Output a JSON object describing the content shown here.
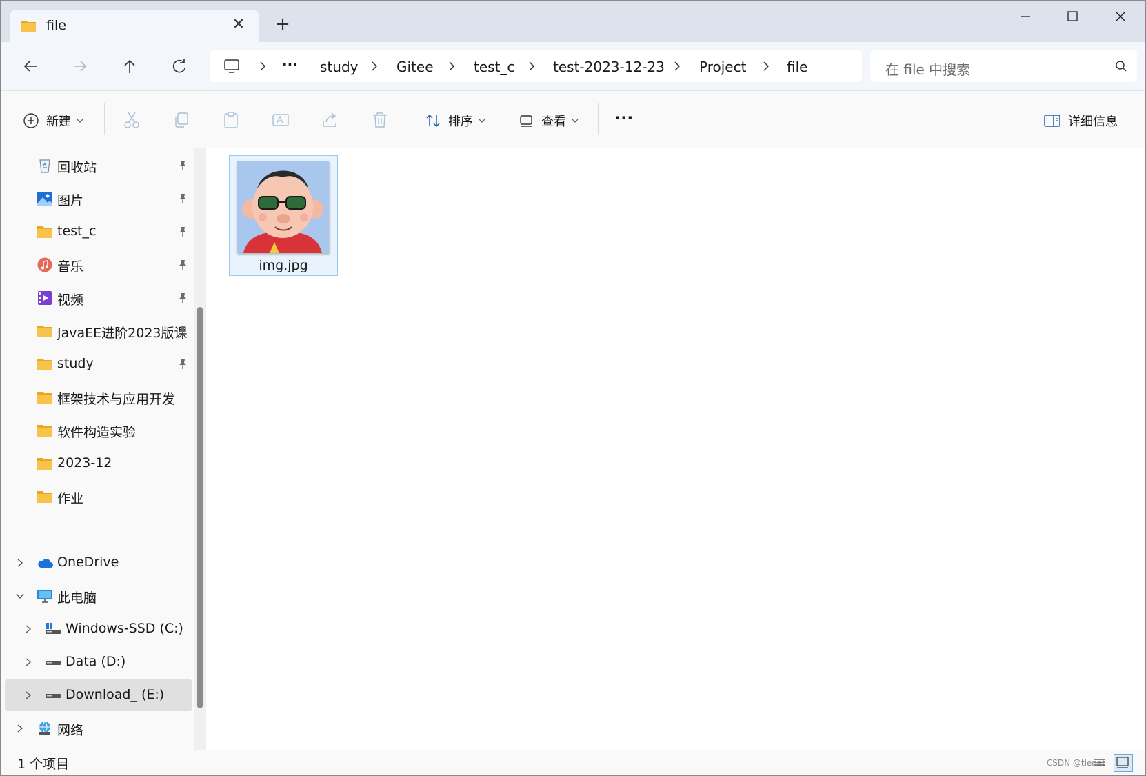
{
  "tab": {
    "title": "file",
    "close": "✕",
    "new_tab": "+"
  },
  "window_controls": {
    "minimize": "minimize",
    "maximize": "maximize",
    "close": "close"
  },
  "breadcrumb": {
    "overflow": "···",
    "items": [
      "study",
      "Gitee",
      "test_c",
      "test-2023-12-23",
      "Project",
      "file"
    ]
  },
  "search": {
    "placeholder": "在 file 中搜索"
  },
  "commands": {
    "new_label": "新建",
    "sort_label": "排序",
    "view_label": "查看",
    "more_label": "···",
    "details_label": "详细信息"
  },
  "sidebar": {
    "quick_access": [
      {
        "label": "回收站",
        "icon": "recycle-bin-icon",
        "pinned": true
      },
      {
        "label": "图片",
        "icon": "pictures-icon",
        "pinned": true
      },
      {
        "label": "test_c",
        "icon": "folder-icon",
        "pinned": true
      },
      {
        "label": "音乐",
        "icon": "music-icon",
        "pinned": true
      },
      {
        "label": "视频",
        "icon": "video-icon",
        "pinned": true
      },
      {
        "label": "JavaEE进阶2023版课",
        "icon": "folder-icon",
        "pinned": true
      },
      {
        "label": "study",
        "icon": "folder-icon",
        "pinned": true
      },
      {
        "label": "框架技术与应用开发",
        "icon": "folder-icon",
        "pinned": false
      },
      {
        "label": "软件构造实验",
        "icon": "folder-icon",
        "pinned": false
      },
      {
        "label": "2023-12",
        "icon": "folder-icon",
        "pinned": false
      },
      {
        "label": "作业",
        "icon": "folder-icon",
        "pinned": false
      }
    ],
    "tree": [
      {
        "label": "OneDrive",
        "icon": "onedrive-icon",
        "expanded": false
      },
      {
        "label": "此电脑",
        "icon": "this-pc-icon",
        "expanded": true
      },
      {
        "label": "Windows-SSD (C:)",
        "icon": "windows-drive-icon",
        "expanded": false
      },
      {
        "label": "Data (D:)",
        "icon": "drive-icon",
        "expanded": false
      },
      {
        "label": "Download_ (E:)",
        "icon": "drive-icon",
        "expanded": false,
        "selected": true
      },
      {
        "label": "网络",
        "icon": "network-icon",
        "expanded": false
      }
    ]
  },
  "files": [
    {
      "name": "img.jpg",
      "type": "image"
    }
  ],
  "status": {
    "count_text": "1 个项目"
  },
  "watermark": "CSDN @tlenet",
  "colors": {
    "title_bar": "#dde3ec",
    "tab_active": "#f3f6fb",
    "folder_yellow": "#f7c34b",
    "accent_blue": "#0a64c8",
    "selection_gray": "#e0e0e0"
  }
}
